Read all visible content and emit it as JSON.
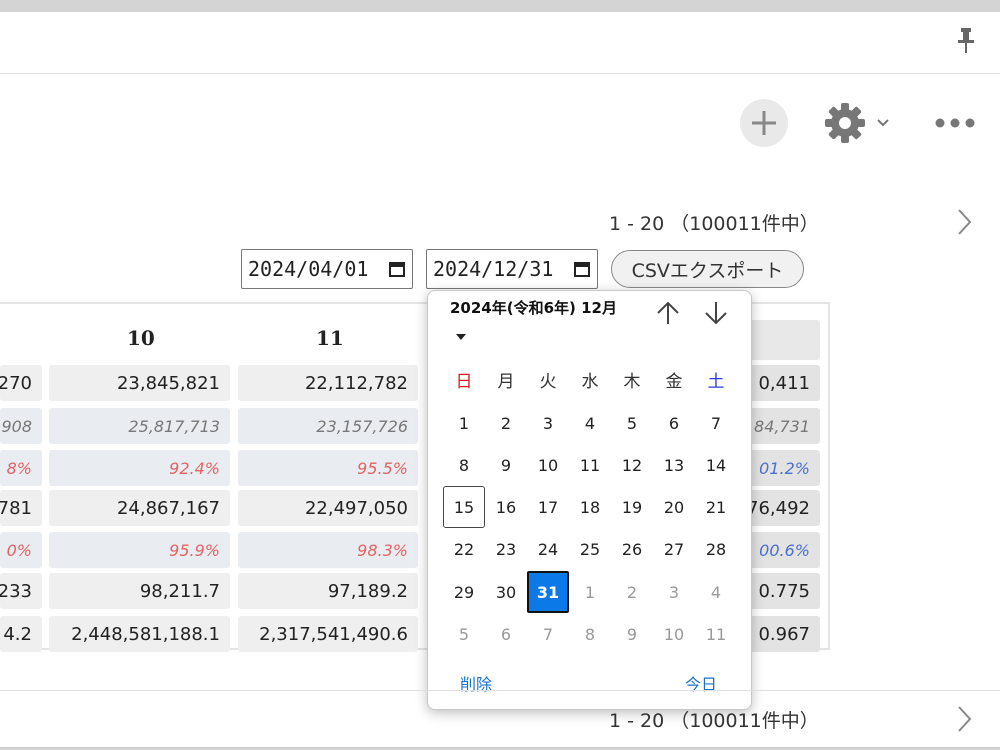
{
  "pagination": {
    "top_text": "1 - 20 （100011件中）",
    "bottom_text": "1 - 20 （100011件中）"
  },
  "filters": {
    "start_date": "2024/04/01",
    "end_date": "2024/12/31",
    "csv_label": "CSVエクスポート"
  },
  "table": {
    "columns": [
      "10",
      "11"
    ],
    "rows": [
      {
        "left": "270",
        "c10": "23,845,821",
        "c11": "22,112,782",
        "right": "0,411",
        "style": "plain"
      },
      {
        "left": "908",
        "c10": "25,817,713",
        "c11": "23,157,726",
        "right": "84,731",
        "style": "ital"
      },
      {
        "left": "8%",
        "c10": "92.4%",
        "c11": "95.5%",
        "right": "01.2%",
        "style": "pct"
      },
      {
        "left": "781",
        "c10": "24,867,167",
        "c11": "22,497,050",
        "right": "76,492",
        "style": "plain"
      },
      {
        "left": "0%",
        "c10": "95.9%",
        "c11": "98.3%",
        "right": "00.6%",
        "style": "pct"
      },
      {
        "left": "233",
        "c10": "98,211.7",
        "c11": "97,189.2",
        "right": "0.775",
        "style": "plain"
      },
      {
        "left": "4.2",
        "c10": "2,448,581,188.1",
        "c11": "2,317,541,490.6",
        "right": "0.967",
        "style": "plain"
      }
    ]
  },
  "datepicker": {
    "title": "2024年(令和6年) 12月",
    "weekdays": [
      "日",
      "月",
      "火",
      "水",
      "木",
      "金",
      "土"
    ],
    "weekday_colors": [
      "#d42020",
      "#333333",
      "#333333",
      "#333333",
      "#333333",
      "#333333",
      "#2a3fd6"
    ],
    "weeks": [
      [
        "1",
        "2",
        "3",
        "4",
        "5",
        "6",
        "7"
      ],
      [
        "8",
        "9",
        "10",
        "11",
        "12",
        "13",
        "14"
      ],
      [
        "15",
        "16",
        "17",
        "18",
        "19",
        "20",
        "21"
      ],
      [
        "22",
        "23",
        "24",
        "25",
        "26",
        "27",
        "28"
      ],
      [
        "29",
        "30",
        "31",
        "1",
        "2",
        "3",
        "4"
      ],
      [
        "5",
        "6",
        "7",
        "8",
        "9",
        "10",
        "11"
      ]
    ],
    "today": "15",
    "selected": "31",
    "clear_label": "削除",
    "today_label": "今日"
  },
  "icons": {
    "pin": "pin-icon",
    "add": "plus-icon",
    "settings": "gear-icon",
    "settings_dropdown": "chevron-down-icon",
    "more": "ellipsis-icon",
    "next_page": "chevron-right-icon",
    "calendar": "calendar-icon",
    "prev_month": "arrow-up-icon",
    "next_month": "arrow-down-icon"
  },
  "colors": {
    "selected_day": "#0b79e8",
    "link": "#1a73c9",
    "negative_pct": "#e36363",
    "positive_pct": "#4a6fd0"
  }
}
